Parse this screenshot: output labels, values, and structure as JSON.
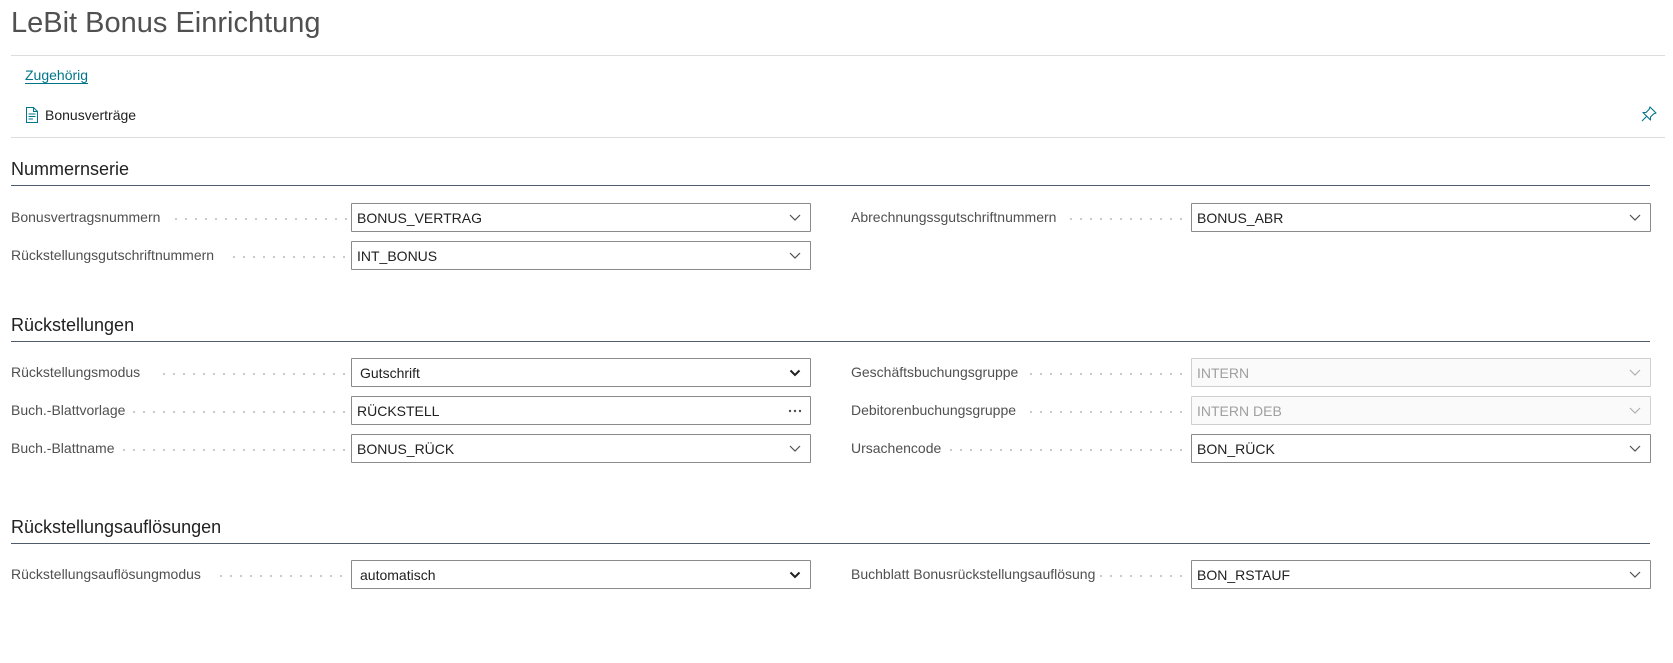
{
  "page": {
    "title": "LeBit Bonus Einrichtung"
  },
  "actions": {
    "tab_label": "Zugehörig",
    "bonusvertraege_label": "Bonusverträge"
  },
  "sections": {
    "nummernserie": {
      "title": "Nummernserie",
      "fields": {
        "bonusvertragsnummern": {
          "label": "Bonusvertragsnummern",
          "value": "BONUS_VERTRAG"
        },
        "abrechnungsgutschriftnummern": {
          "label": "Abrechnungssgutschriftnummern",
          "value": "BONUS_ABR"
        },
        "rueckstellungsgutschriftnummern": {
          "label": "Rückstellungsgutschriftnummern",
          "value": "INT_BONUS"
        }
      }
    },
    "rueckstellungen": {
      "title": "Rückstellungen",
      "fields": {
        "modus": {
          "label": "Rückstellungsmodus",
          "value": "Gutschrift"
        },
        "geschaeftsbuchungsgruppe": {
          "label": "Geschäftsbuchungsgruppe",
          "value": "INTERN"
        },
        "blattvorlage": {
          "label": "Buch.-Blattvorlage",
          "value": "RÜCKSTELL"
        },
        "debitorenbuchungsgruppe": {
          "label": "Debitorenbuchungsgruppe",
          "value": "INTERN DEB"
        },
        "blattname": {
          "label": "Buch.-Blattname",
          "value": "BONUS_RÜCK"
        },
        "ursachencode": {
          "label": "Ursachencode",
          "value": "BON_RÜCK"
        }
      }
    },
    "aufloesungen": {
      "title": "Rückstellungsauflösungen",
      "fields": {
        "modus": {
          "label": "Rückstellungsauflösungmodus",
          "value": "automatisch"
        },
        "buchblatt": {
          "label": "Buchblatt Bonusrückstellungsauflösung",
          "value": "BON_RSTAUF"
        }
      }
    }
  },
  "colors": {
    "accent": "#00758a",
    "section_rule": "#505c6d"
  }
}
